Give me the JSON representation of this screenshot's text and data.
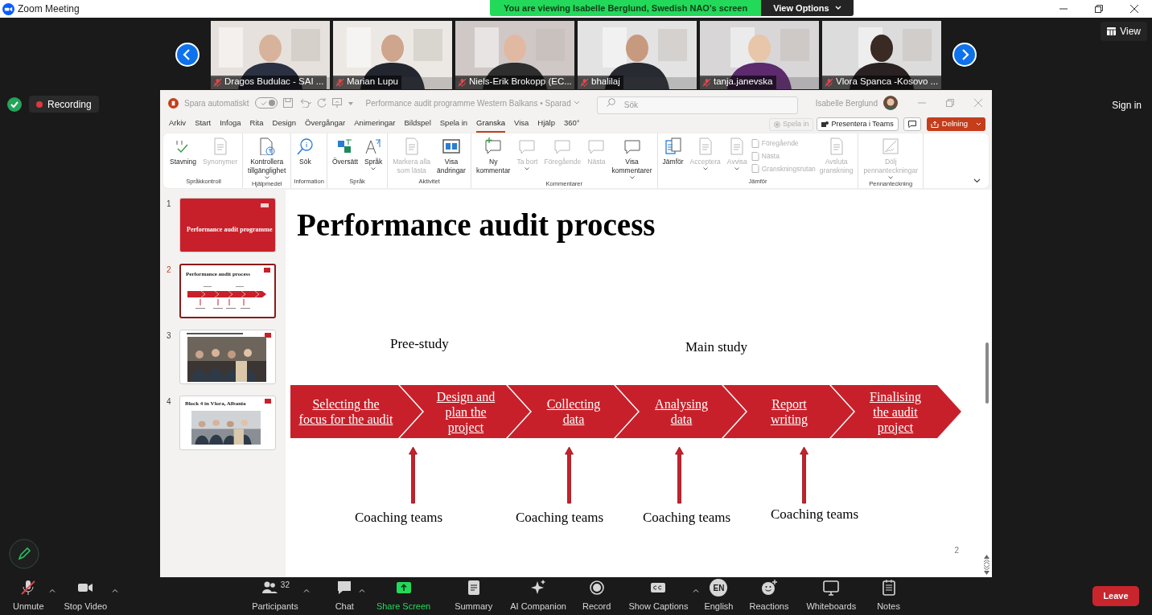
{
  "zoom_window": {
    "title": "Zoom Meeting",
    "share_banner": "You are viewing Isabelle Berglund, Swedish NAO's screen",
    "view_options": "View Options"
  },
  "participants": [
    {
      "name": "Dragos Budulac - SAI ...",
      "muted": true
    },
    {
      "name": "Marian Lupu",
      "muted": true
    },
    {
      "name": "Niels-Erik Brokopp (EC...",
      "muted": true
    },
    {
      "name": "bhalilaj",
      "muted": true
    },
    {
      "name": "tanja.janevska",
      "muted": true
    },
    {
      "name": "Vlora Spanca -Kosovo ...",
      "muted": true
    }
  ],
  "view_button": "View",
  "recording": "Recording",
  "sign_in": "Sign in",
  "powerpoint": {
    "autosave": {
      "label": "Spara automatiskt",
      "on": true
    },
    "document": "Performance audit programme Western Balkans • Sparad",
    "search": {
      "placeholder": "Sök"
    },
    "user": "Isabelle Berglund",
    "tabs": [
      {
        "label": "Arkiv",
        "selected": false
      },
      {
        "label": "Start",
        "selected": false
      },
      {
        "label": "Infoga",
        "selected": false
      },
      {
        "label": "Rita",
        "selected": false
      },
      {
        "label": "Design",
        "selected": false
      },
      {
        "label": "Övergångar",
        "selected": false
      },
      {
        "label": "Animeringar",
        "selected": false
      },
      {
        "label": "Bildspel",
        "selected": false
      },
      {
        "label": "Spela in",
        "selected": false
      },
      {
        "label": "Granska",
        "selected": true
      },
      {
        "label": "Visa",
        "selected": false
      },
      {
        "label": "Hjälp",
        "selected": false
      },
      {
        "label": "360°",
        "selected": false
      }
    ],
    "record_button": {
      "label": "Spela in",
      "disabled": true
    },
    "teams_button": "Presentera i Teams",
    "share_button": "Delning",
    "ribbon": [
      {
        "label": "Språkkontroll",
        "items": [
          {
            "kind": "large",
            "label": "Stavning",
            "disabled": false,
            "dropdown": false
          },
          {
            "kind": "large",
            "label": "Synonymer",
            "disabled": true,
            "dropdown": false
          }
        ]
      },
      {
        "label": "Hjälpmedel",
        "items": [
          {
            "kind": "large",
            "label": "Kontrollera\ntillgänglighet",
            "disabled": false,
            "dropdown": true
          }
        ]
      },
      {
        "label": "Information",
        "items": [
          {
            "kind": "large",
            "label": "Sök",
            "disabled": false,
            "dropdown": false
          }
        ]
      },
      {
        "label": "Språk",
        "items": [
          {
            "kind": "large",
            "label": "Översätt",
            "disabled": false,
            "dropdown": false
          },
          {
            "kind": "large",
            "label": "Språk",
            "disabled": false,
            "dropdown": true
          }
        ]
      },
      {
        "label": "Aktivitet",
        "items": [
          {
            "kind": "large",
            "label": "Markera alla\nsom lästa",
            "disabled": true,
            "dropdown": false
          },
          {
            "kind": "large",
            "label": "Visa\nändringar",
            "disabled": false,
            "dropdown": false
          }
        ]
      },
      {
        "label": "Kommentarer",
        "items": [
          {
            "kind": "large",
            "label": "Ny\nkommentar",
            "disabled": false,
            "dropdown": false
          },
          {
            "kind": "large",
            "label": "Ta bort",
            "disabled": true,
            "dropdown": true
          },
          {
            "kind": "large",
            "label": "Föregående",
            "disabled": true,
            "dropdown": false
          },
          {
            "kind": "large",
            "label": "Nästa",
            "disabled": true,
            "dropdown": false
          },
          {
            "kind": "large",
            "label": "Visa\nkommentarer",
            "disabled": false,
            "dropdown": true
          }
        ]
      },
      {
        "label": "Jämför",
        "items": [
          {
            "kind": "large",
            "label": "Jämför",
            "disabled": false,
            "dropdown": false
          },
          {
            "kind": "large",
            "label": "Acceptera",
            "disabled": true,
            "dropdown": true
          },
          {
            "kind": "large",
            "label": "Avvisa",
            "disabled": true,
            "dropdown": true
          },
          {
            "kind": "small",
            "label": "Föregående",
            "disabled": true,
            "dropdown": false
          },
          {
            "kind": "small",
            "label": "Nästa",
            "disabled": true,
            "dropdown": false
          },
          {
            "kind": "small",
            "label": "Granskningsrutan",
            "disabled": true,
            "dropdown": false
          },
          {
            "kind": "large",
            "label": "Avsluta\ngranskning",
            "disabled": true,
            "dropdown": false
          }
        ]
      },
      {
        "label": "Pennanteckning",
        "items": [
          {
            "kind": "large",
            "label": "Dölj\npennanteckningar",
            "disabled": true,
            "dropdown": true
          }
        ]
      }
    ]
  },
  "slides": [
    {
      "number": "1",
      "selected": false,
      "kind": "title",
      "title": "Performance audit programme"
    },
    {
      "number": "2",
      "selected": true,
      "kind": "diagram",
      "title": "Performance audit process"
    },
    {
      "number": "3",
      "selected": false
    },
    {
      "number": "4",
      "selected": false,
      "title": "Block 4 in Vlora, Albania"
    }
  ],
  "slide": {
    "title": "Performance audit process",
    "phases": [
      {
        "label": "Pree-study"
      },
      {
        "label": "Main study"
      }
    ],
    "steps": [
      {
        "label": "Selecting the\nfocus for the audit"
      },
      {
        "label": "Design and\nplan the\nproject"
      },
      {
        "label": "Collecting\ndata"
      },
      {
        "label": "Analysing\ndata"
      },
      {
        "label": "Report\nwriting"
      },
      {
        "label": "Finalising\nthe audit\nproject"
      }
    ],
    "coaching": [
      {
        "label": "Coaching teams"
      },
      {
        "label": "Coaching teams"
      },
      {
        "label": "Coaching teams"
      },
      {
        "label": "Coaching teams"
      }
    ],
    "page_number": "2"
  },
  "toolbar": [
    {
      "label": "Unmute",
      "kind": "normal",
      "menu": true
    },
    {
      "label": "Stop Video",
      "kind": "normal",
      "menu": true
    },
    {
      "label": "Participants",
      "kind": "normal",
      "menu": true,
      "count": "32"
    },
    {
      "label": "Chat",
      "kind": "normal",
      "menu": true
    },
    {
      "label": "Share Screen",
      "kind": "share",
      "menu": false
    },
    {
      "label": "Summary",
      "kind": "normal",
      "menu": false
    },
    {
      "label": "AI Companion",
      "kind": "normal",
      "menu": false
    },
    {
      "label": "Record",
      "kind": "normal",
      "menu": false
    },
    {
      "label": "Show Captions",
      "kind": "normal",
      "menu": true
    },
    {
      "label": "English",
      "kind": "normal",
      "menu": false,
      "badge": "EN"
    },
    {
      "label": "Reactions",
      "kind": "normal",
      "menu": false
    },
    {
      "label": "Whiteboards",
      "kind": "normal",
      "menu": false
    },
    {
      "label": "Notes",
      "kind": "normal",
      "menu": false
    }
  ],
  "leave": "Leave"
}
